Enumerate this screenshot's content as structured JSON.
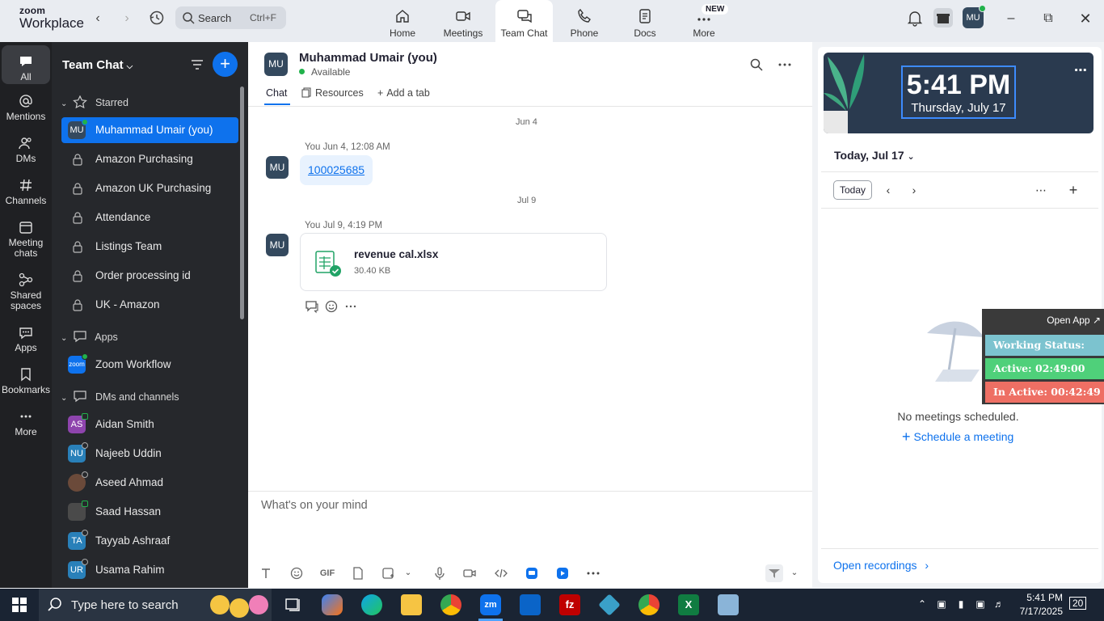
{
  "app": {
    "logo_line1": "zoom",
    "logo_line2": "Workplace",
    "search_label": "Search",
    "search_shortcut": "Ctrl+F"
  },
  "nav_tabs": [
    {
      "label": "Home",
      "icon": "home-icon"
    },
    {
      "label": "Meetings",
      "icon": "video-icon"
    },
    {
      "label": "Team Chat",
      "icon": "chat-icon",
      "active": true
    },
    {
      "label": "Phone",
      "icon": "phone-icon"
    },
    {
      "label": "Docs",
      "icon": "docs-icon"
    },
    {
      "label": "More",
      "icon": "more-icon",
      "badge": "NEW"
    }
  ],
  "user": {
    "initials": "MU"
  },
  "rail": [
    {
      "label": "All",
      "icon": "chat-bubble-icon",
      "active": true
    },
    {
      "label": "Mentions",
      "icon": "at-icon"
    },
    {
      "label": "DMs",
      "icon": "people-icon"
    },
    {
      "label": "Channels",
      "icon": "hash-icon"
    },
    {
      "label": "Meeting chats",
      "icon": "calendar-icon"
    },
    {
      "label": "Shared spaces",
      "icon": "shared-icon"
    },
    {
      "label": "Apps",
      "icon": "apps-icon"
    },
    {
      "label": "Bookmarks",
      "icon": "bookmark-icon"
    },
    {
      "label": "More",
      "icon": "ellipsis-icon"
    }
  ],
  "list": {
    "title": "Team Chat",
    "sections": {
      "starred": "Starred",
      "apps": "Apps",
      "dms": "DMs and channels"
    },
    "starred_items": [
      {
        "name": "Muhammad Umair (you)",
        "initials": "MU",
        "selected": true
      },
      {
        "name": "Amazon Purchasing"
      },
      {
        "name": "Amazon UK Purchasing"
      },
      {
        "name": "Attendance"
      },
      {
        "name": "Listings Team"
      },
      {
        "name": "Order processing id"
      },
      {
        "name": "UK - Amazon"
      }
    ],
    "apps_items": [
      {
        "name": "Zoom Workflow",
        "initials": "zoom"
      }
    ],
    "dm_items": [
      {
        "name": "Aidan Smith",
        "initials": "AS",
        "color": "#8e44ad"
      },
      {
        "name": "Najeeb Uddin",
        "initials": "NU",
        "color": "#2980b9"
      },
      {
        "name": "Aseed Ahmad",
        "initials": "",
        "color": "#6b4a3a"
      },
      {
        "name": "Saad Hassan",
        "initials": "",
        "color": "#4a4a4a"
      },
      {
        "name": "Tayyab Ashraaf",
        "initials": "TA",
        "color": "#2980b9"
      },
      {
        "name": "Usama Rahim",
        "initials": "UR",
        "color": "#2980b9"
      }
    ]
  },
  "chat": {
    "name": "Muhammad Umair (you)",
    "initials": "MU",
    "status": "Available",
    "tabs": [
      "Chat",
      "Resources",
      "Add a tab"
    ],
    "messages": [
      {
        "date": "Jun 4",
        "meta": "You Jun 4, 12:08 AM",
        "link": "100025685"
      },
      {
        "date": "Jul 9",
        "meta": "You Jul 9, 4:19 PM",
        "file_name": "revenue cal.xlsx",
        "file_size": "30.40 KB"
      }
    ],
    "compose_placeholder": "What's on your mind",
    "gif_label": "GIF"
  },
  "calendar": {
    "clock_time": "5:41 PM",
    "clock_date": "Thursday, July 17",
    "date_label": "Today, Jul 17",
    "today_btn": "Today",
    "no_meetings": "No meetings scheduled.",
    "schedule": "Schedule a meeting",
    "open_recordings": "Open recordings"
  },
  "widget": {
    "open_app": "Open App",
    "working_status": "Working Status: Active",
    "active": "Active: 02:49:00",
    "inactive": "In Active: 00:42:49",
    "colors": {
      "status": "#7cc3cf",
      "active": "#4fd07a",
      "inactive": "#ee6f64"
    }
  },
  "taskbar": {
    "search_text": "Type here to search",
    "time": "5:41 PM",
    "date": "7/17/2025",
    "notifications": "20"
  }
}
